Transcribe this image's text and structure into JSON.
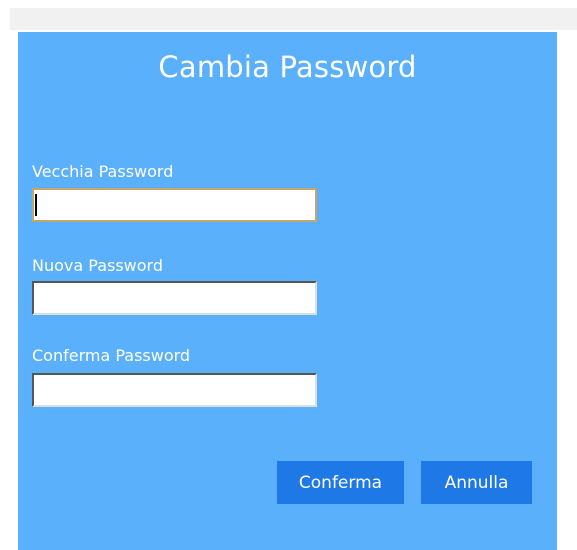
{
  "dialog": {
    "title": "Cambia Password",
    "fields": [
      {
        "label": "Vecchia Password",
        "value": "",
        "placeholder": ""
      },
      {
        "label": "Nuova Password",
        "value": "",
        "placeholder": ""
      },
      {
        "label": "Conferma Password",
        "value": "",
        "placeholder": ""
      }
    ],
    "buttons": {
      "confirm_label": "Conferma",
      "cancel_label": "Annulla"
    }
  },
  "colors": {
    "dialog_background": "#5ab0fb",
    "button_background": "#1e78e6",
    "text": "#ffffff",
    "focused_border": "#c9a46a"
  }
}
